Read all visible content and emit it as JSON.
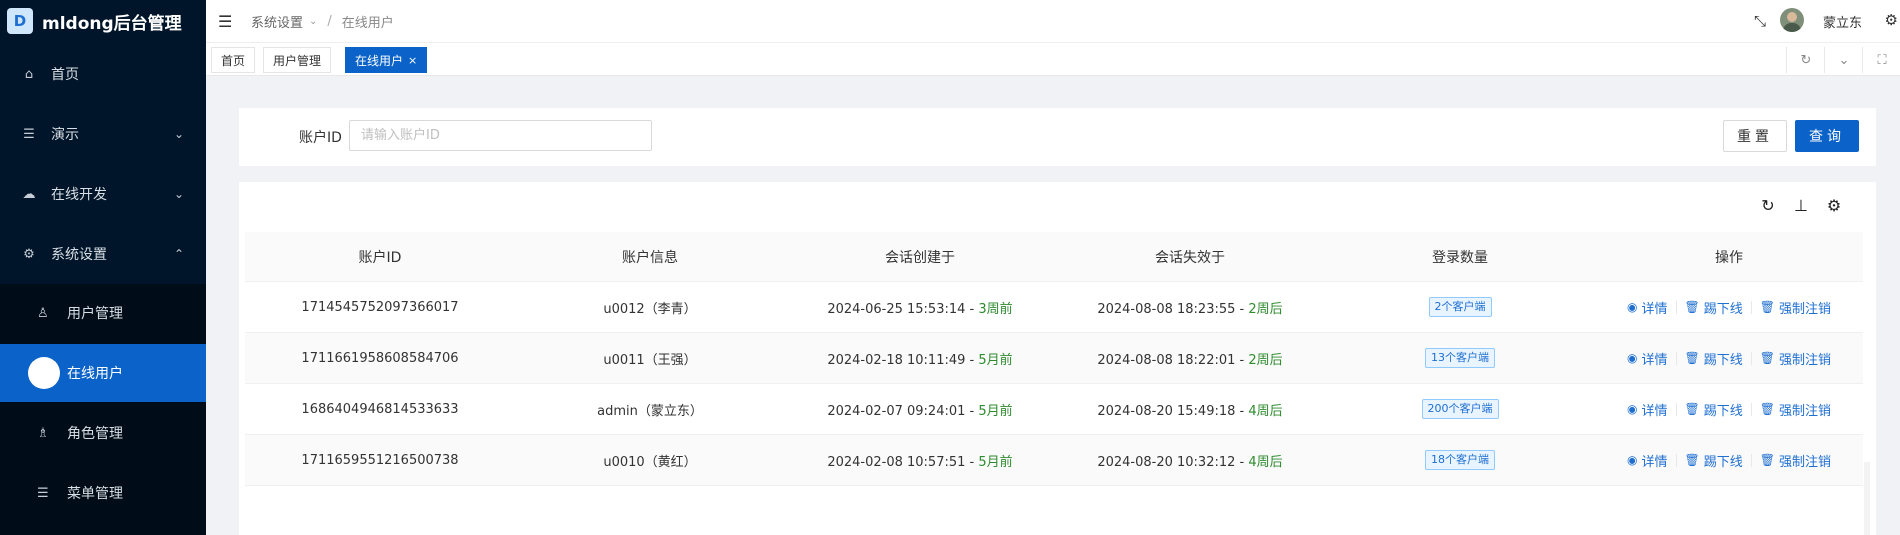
{
  "app": {
    "logo_letter": "D",
    "title": "mldong后台管理"
  },
  "sidebar": {
    "items": [
      {
        "label": "首页",
        "icon": "home-icon"
      },
      {
        "label": "演示",
        "icon": "list-icon"
      },
      {
        "label": "在线开发",
        "icon": "cloud-icon"
      },
      {
        "label": "系统设置",
        "icon": "gear-icon"
      }
    ],
    "submenu": [
      {
        "label": "用户管理",
        "icon": "user-icon"
      },
      {
        "label": "在线用户",
        "icon": "online-user-icon"
      },
      {
        "label": "角色管理",
        "icon": "role-icon"
      },
      {
        "label": "菜单管理",
        "icon": "menu-icon"
      }
    ]
  },
  "header": {
    "breadcrumb": {
      "parent": "系统设置",
      "current": "在线用户"
    },
    "username": "蒙立东"
  },
  "tabs": [
    {
      "label": "首页"
    },
    {
      "label": "用户管理"
    },
    {
      "label": "在线用户",
      "close": "×"
    }
  ],
  "search": {
    "label": "账户ID",
    "placeholder": "请输入账户ID",
    "reset_label": "重置",
    "query_label": "查询"
  },
  "table": {
    "columns": [
      "账户ID",
      "账户信息",
      "会话创建于",
      "会话失效于",
      "登录数量",
      "操作"
    ],
    "rows": [
      {
        "id": "1714545752097366017",
        "info": "u0012（李青）",
        "created": "2024-06-25 15:53:14",
        "created_ago": "3周前",
        "expires": "2024-08-08 18:23:55",
        "expires_ago": "2周后",
        "logins": "2个客户端"
      },
      {
        "id": "1711661958608584706",
        "info": "u0011（王强）",
        "created": "2024-02-18 10:11:49",
        "created_ago": "5月前",
        "expires": "2024-08-08 18:22:01",
        "expires_ago": "2周后",
        "logins": "13个客户端"
      },
      {
        "id": "1686404946814533633",
        "info": "admin（蒙立东）",
        "created": "2024-02-07 09:24:01",
        "created_ago": "5月前",
        "expires": "2024-08-20 15:49:18",
        "expires_ago": "4周后",
        "logins": "200个客户端"
      },
      {
        "id": "1711659551216500738",
        "info": "u0010（黄红）",
        "created": "2024-02-08 10:57:51",
        "created_ago": "5月前",
        "expires": "2024-08-20 10:32:12",
        "expires_ago": "4周后",
        "logins": "18个客户端"
      }
    ],
    "actions": {
      "detail": "详情",
      "kick": "踢下线",
      "logout": "强制注销"
    },
    "separator": " - "
  }
}
